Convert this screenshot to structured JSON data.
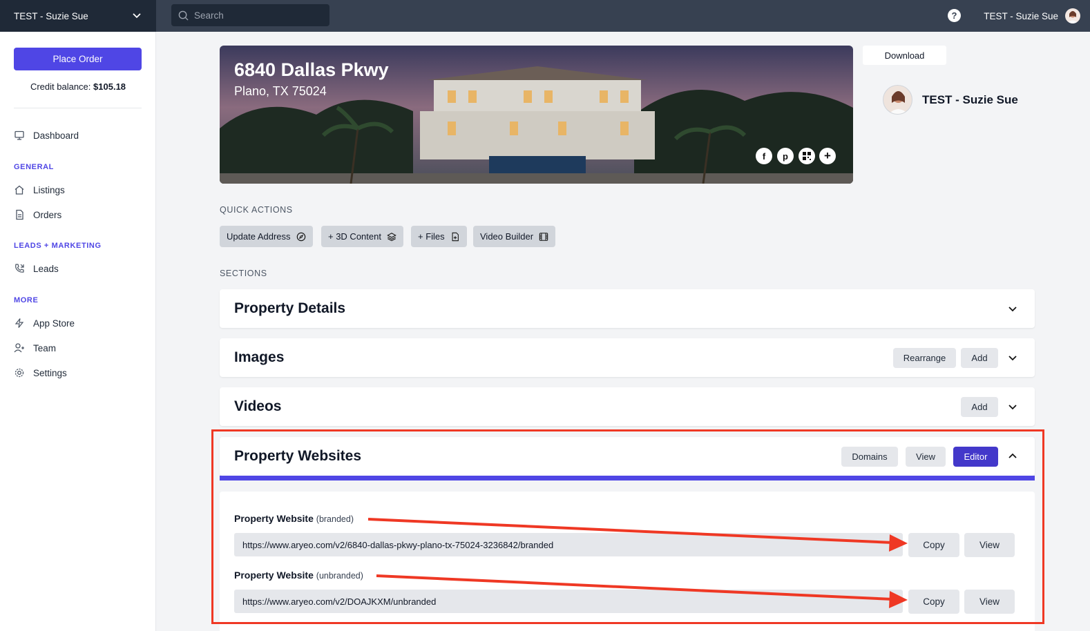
{
  "topbar": {
    "account_name": "TEST - Suzie Sue",
    "search_placeholder": "Search",
    "user_name": "TEST - Suzie Sue"
  },
  "sidebar": {
    "place_order": "Place Order",
    "credit_label": "Credit balance:",
    "credit_value": "$105.18",
    "items": [
      {
        "label": "Dashboard",
        "icon": "monitor-icon"
      },
      {
        "header": "GENERAL"
      },
      {
        "label": "Listings",
        "icon": "home-icon"
      },
      {
        "label": "Orders",
        "icon": "document-icon"
      },
      {
        "header": "LEADS + MARKETING"
      },
      {
        "label": "Leads",
        "icon": "phone-icon"
      },
      {
        "header": "MORE"
      },
      {
        "label": "App Store",
        "icon": "lightning-icon"
      },
      {
        "label": "Team",
        "icon": "user-plus-icon"
      },
      {
        "label": "Settings",
        "icon": "gear-icon"
      }
    ]
  },
  "listing": {
    "address": "6840 Dallas Pkwy",
    "city_line": "Plano, TX 75024",
    "download_label": "Download",
    "agent_name": "TEST - Suzie Sue"
  },
  "quick_actions": {
    "title": "QUICK ACTIONS",
    "buttons": [
      "Update Address",
      "+ 3D Content",
      "+ Files",
      "Video Builder"
    ]
  },
  "sections": {
    "title": "SECTIONS",
    "property_details": "Property Details",
    "images": {
      "title": "Images",
      "rearrange": "Rearrange",
      "add": "Add"
    },
    "videos": {
      "title": "Videos",
      "add": "Add"
    },
    "websites": {
      "title": "Property Websites",
      "domains": "Domains",
      "view": "View",
      "editor": "Editor",
      "branded": {
        "label": "Property Website",
        "tag": "(branded)",
        "url": "https://www.aryeo.com/v2/6840-dallas-pkwy-plano-tx-75024-3236842/branded",
        "copy": "Copy",
        "view": "View"
      },
      "unbranded": {
        "label": "Property Website",
        "tag": "(unbranded)",
        "url": "https://www.aryeo.com/v2/DOAJKXM/unbranded",
        "copy": "Copy",
        "view": "View"
      }
    }
  },
  "colors": {
    "accent": "#4f46e5",
    "annotation": "#ef3824",
    "topbar": "#374151"
  }
}
